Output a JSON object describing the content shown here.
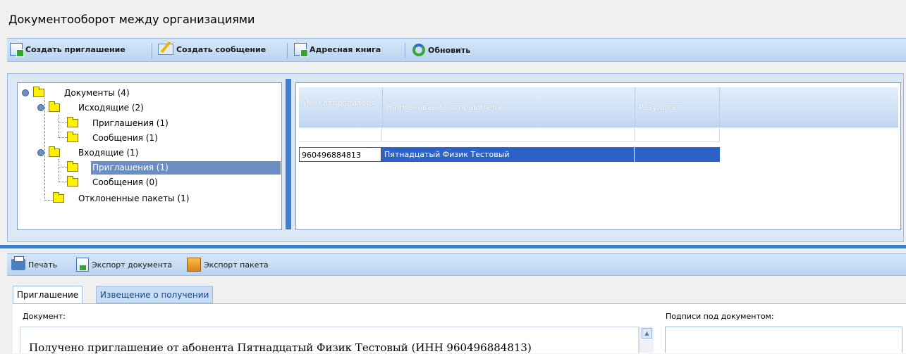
{
  "window": {
    "title": "Документооборот между организациями"
  },
  "toolbar": {
    "create_invite": "Создать приглашение",
    "create_message": "Создать сообщение",
    "address_book": "Адресная книга",
    "refresh": "Обновить"
  },
  "tree": {
    "root": "Документы (4)",
    "outgoing": "Исходящие (2)",
    "out_invites": "Приглашения (1)",
    "out_messages": "Сообщения (1)",
    "incoming": "Входящие (1)",
    "in_invites": "Приглашения (1)",
    "in_messages": "Сообщения (0)",
    "rejected": "Отклоненные пакеты (1)"
  },
  "grid": {
    "columns": [
      "ИНН отправителя",
      "Наименование отправителя",
      "Результат"
    ],
    "rows": [
      {
        "inn": "960496884813",
        "name": "Пятнадцатый Физик Тестовый",
        "result": ""
      }
    ]
  },
  "bottom_toolbar": {
    "print": "Печать",
    "export_doc": "Экспорт документа",
    "export_pack": "Экспорт пакета"
  },
  "tabs": [
    {
      "label": "Приглашение",
      "active": true
    },
    {
      "label": "Извещение о получении",
      "active": false
    }
  ],
  "document": {
    "label": "Документ:",
    "text": "Получено приглашение от абонента Пятнадцатый Физик Тестовый (ИНН 960496884813)"
  },
  "signatures": {
    "label": "Подписи под документом:"
  },
  "colors": {
    "accent": "#3f7fcc",
    "selection": "#6b8fc4",
    "row_selected": "#2d63c8"
  }
}
